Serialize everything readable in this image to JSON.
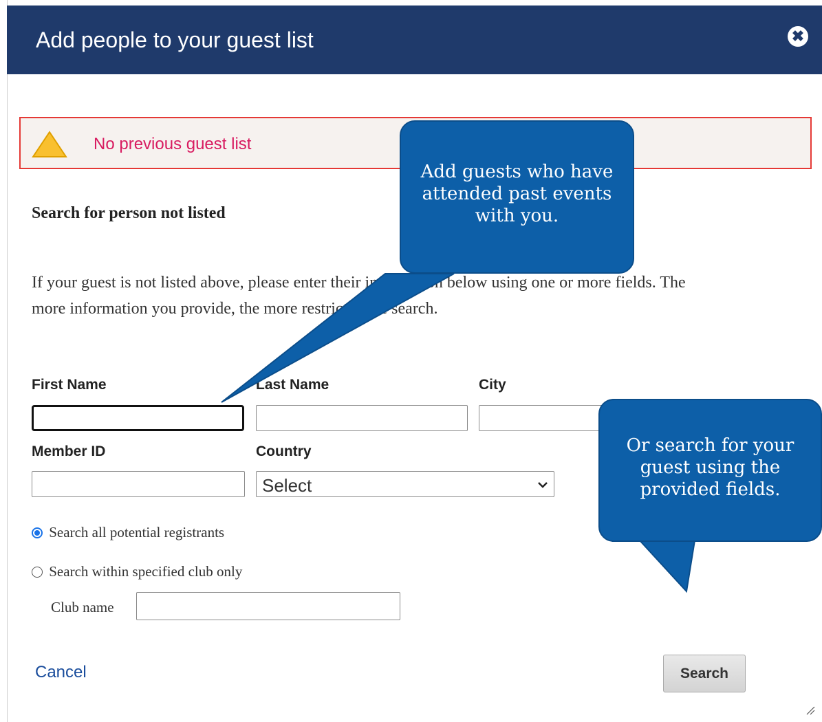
{
  "dialog": {
    "title": "Add people to your guest list",
    "close_icon": "close-icon",
    "close_glyph": "✖"
  },
  "alert": {
    "message": "No previous guest list",
    "icon": "warning-triangle-icon"
  },
  "search": {
    "heading": "Search for person not listed",
    "instructions": "If your guest is not listed above, please enter their information below using one or more fields. The more information you provide, the more restricted the search.",
    "first_name_label": "First Name",
    "last_name_label": "Last Name",
    "city_label": "City",
    "member_id_label": "Member ID",
    "country_label": "Country",
    "country_selected": "Select",
    "first_name_value": "",
    "last_name_value": "",
    "city_value": "",
    "member_id_value": "",
    "club_name_value": ""
  },
  "scope": {
    "option_all": "Search all potential registrants",
    "option_club": "Search within specified club only",
    "club_name_label": "Club name",
    "selected": "all"
  },
  "actions": {
    "cancel_label": "Cancel",
    "search_label": "Search"
  },
  "callouts": {
    "guests_tip": "Add guests who have attended past events with you.",
    "search_tip": "Or search for your guest using the provided fields."
  },
  "colors": {
    "header": "#1f3a6b",
    "alert_border": "#e53935",
    "alert_text": "#d81b60",
    "callout": "#0d5fa8",
    "link": "#1a4d9c"
  }
}
